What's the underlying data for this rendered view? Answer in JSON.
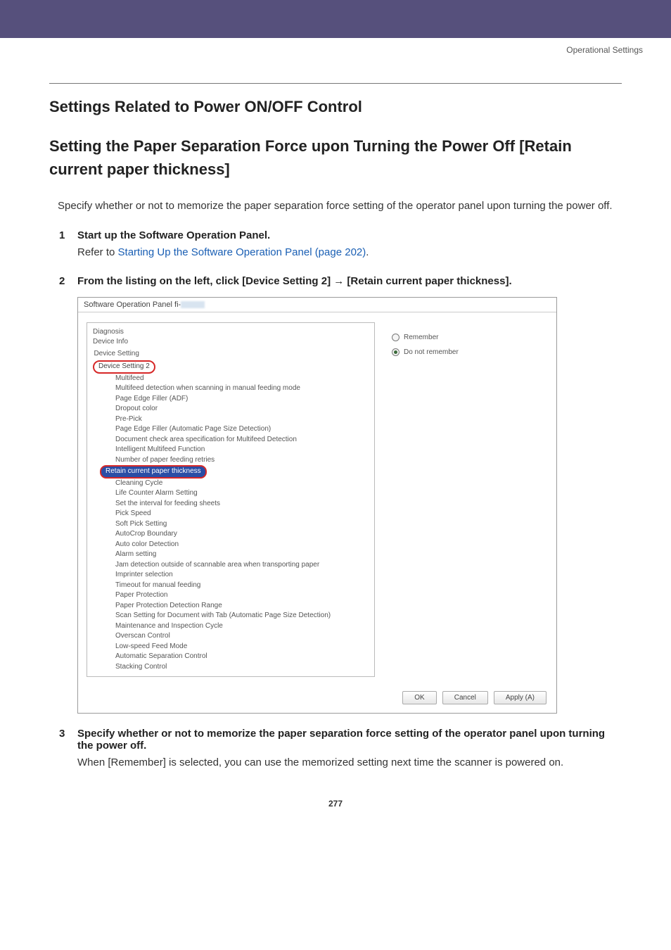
{
  "breadcrumb": "Operational Settings",
  "heading_group": "Settings Related to Power ON/OFF Control",
  "heading_setting": "Setting the Paper Separation Force upon Turning the Power Off [Retain current paper thickness]",
  "intro": "Specify whether or not to memorize the paper separation force setting of the operator panel upon turning the power off.",
  "steps": {
    "s1": {
      "head": "Start up the Software Operation Panel.",
      "body_prefix": "Refer to ",
      "body_link": "Starting Up the Software Operation Panel (page 202)",
      "body_suffix": "."
    },
    "s2": {
      "head": "From the listing on the left, click [Device Setting 2] → [Retain current paper thickness]."
    },
    "s3": {
      "head": "Specify whether or not to memorize the paper separation force setting of the operator panel upon turning the power off.",
      "body": "When [Remember] is selected, you can use the memorized setting next time the scanner is powered on."
    }
  },
  "sop": {
    "title": "Software Operation Panel fi-",
    "tree": {
      "diagnosis": "Diagnosis",
      "device_info": "Device Info",
      "device_setting": "Device Setting",
      "device_setting2": "Device Setting 2",
      "items": {
        "multifeed": "Multifeed",
        "mf_manual": "Multifeed detection when scanning in manual feeding mode",
        "pef_adf": "Page Edge Filler (ADF)",
        "dropout": "Dropout color",
        "prepick": "Pre-Pick",
        "pef_auto": "Page Edge Filler (Automatic Page Size Detection)",
        "doc_check": "Document check area specification for Multifeed Detection",
        "intel_mf": "Intelligent Multifeed Function",
        "num_retries": "Number of paper feeding retries",
        "retain_pt": "Retain current paper thickness",
        "clean_cycle": "Cleaning Cycle",
        "life_alarm": "Life Counter Alarm Setting",
        "interval_feed": "Set the interval for feeding sheets",
        "pick_speed": "Pick Speed",
        "soft_pick": "Soft Pick Setting",
        "autocrop": "AutoCrop Boundary",
        "auto_color": "Auto color Detection",
        "alarm": "Alarm setting",
        "jam_outside": "Jam detection outside of scannable area when transporting paper",
        "imprinter": "Imprinter selection",
        "timeout_manual": "Timeout for manual feeding",
        "paper_prot": "Paper Protection",
        "paper_prot_range": "Paper Protection Detection Range",
        "scan_tab": "Scan Setting for Document with Tab (Automatic Page Size Detection)",
        "maint_insp": "Maintenance and Inspection Cycle",
        "overscan": "Overscan Control",
        "low_speed": "Low-speed Feed Mode",
        "auto_sep": "Automatic Separation Control",
        "stacking": "Stacking Control"
      }
    },
    "radios": {
      "remember": "Remember",
      "dont": "Do not remember"
    },
    "buttons": {
      "ok": "OK",
      "cancel": "Cancel",
      "apply": "Apply (A)"
    }
  },
  "page_no": "277"
}
